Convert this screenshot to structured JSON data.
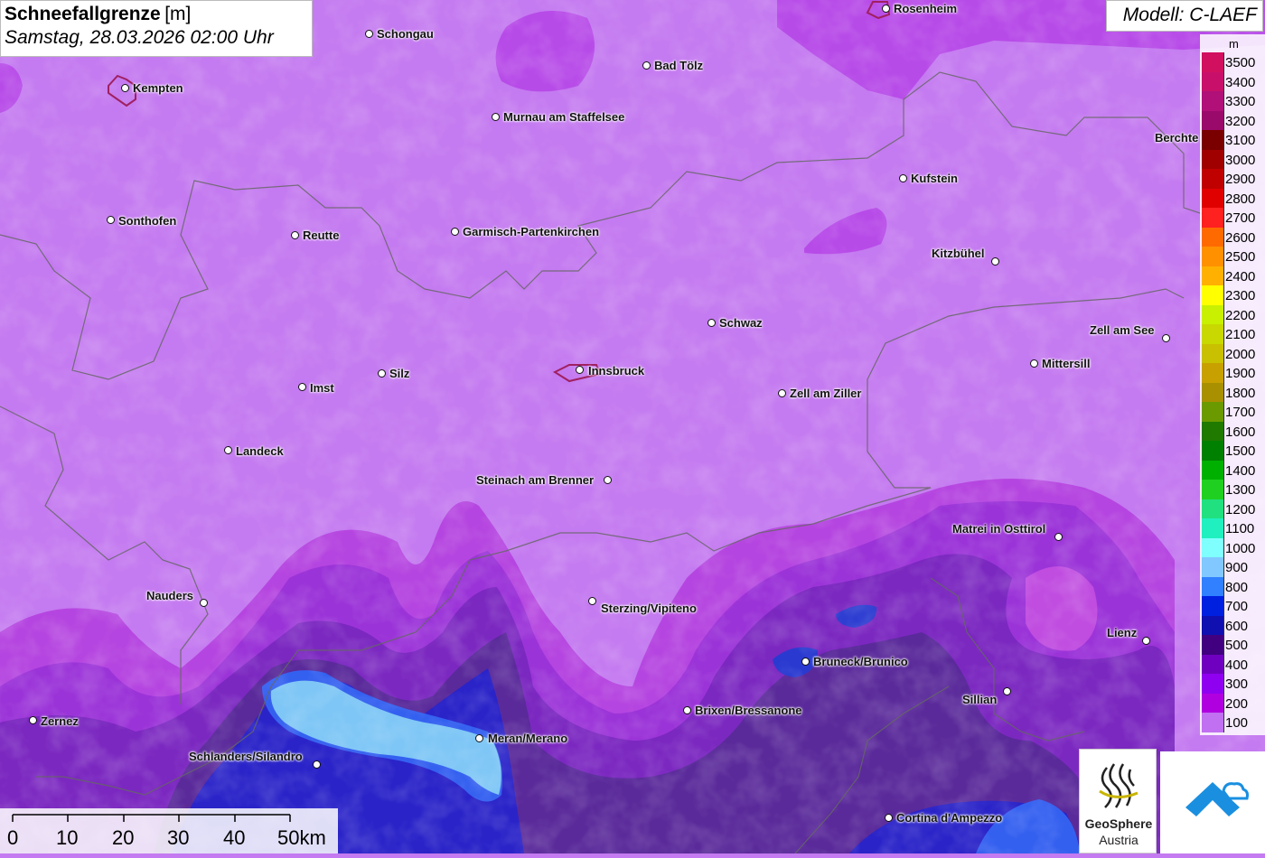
{
  "title": {
    "main": "Schneefallgrenze",
    "unit": "[m]",
    "date": "Samstag, 28.03.2026 02:00 Uhr"
  },
  "model": "Modell: C-LAEF",
  "legend": {
    "unit": "m",
    "entries": [
      {
        "label": "3500",
        "color": "#d1105f"
      },
      {
        "label": "3400",
        "color": "#c8106a"
      },
      {
        "label": "3300",
        "color": "#b01078"
      },
      {
        "label": "3200",
        "color": "#9a0a6a"
      },
      {
        "label": "3100",
        "color": "#7a0000"
      },
      {
        "label": "3000",
        "color": "#a00000"
      },
      {
        "label": "2900",
        "color": "#c00000"
      },
      {
        "label": "2800",
        "color": "#e00000"
      },
      {
        "label": "2700",
        "color": "#ff2020"
      },
      {
        "label": "2600",
        "color": "#ff6a00"
      },
      {
        "label": "2500",
        "color": "#ff9000"
      },
      {
        "label": "2400",
        "color": "#ffb000"
      },
      {
        "label": "2300",
        "color": "#ffff00"
      },
      {
        "label": "2200",
        "color": "#c8f000"
      },
      {
        "label": "2100",
        "color": "#c8d800"
      },
      {
        "label": "2000",
        "color": "#c8c000"
      },
      {
        "label": "1900",
        "color": "#c8a000"
      },
      {
        "label": "1800",
        "color": "#a89000"
      },
      {
        "label": "1700",
        "color": "#6a9a00"
      },
      {
        "label": "1600",
        "color": "#207a00"
      },
      {
        "label": "1500",
        "color": "#008000"
      },
      {
        "label": "1400",
        "color": "#00b000"
      },
      {
        "label": "1300",
        "color": "#20d020"
      },
      {
        "label": "1200",
        "color": "#20e080"
      },
      {
        "label": "1100",
        "color": "#20f0c0"
      },
      {
        "label": "1000",
        "color": "#80ffff"
      },
      {
        "label": "900",
        "color": "#80c8ff"
      },
      {
        "label": "800",
        "color": "#3080ff"
      },
      {
        "label": "700",
        "color": "#0020e0"
      },
      {
        "label": "600",
        "color": "#1010b0"
      },
      {
        "label": "500",
        "color": "#400080"
      },
      {
        "label": "400",
        "color": "#7000c0"
      },
      {
        "label": "300",
        "color": "#9000f0"
      },
      {
        "label": "200",
        "color": "#b000e0"
      },
      {
        "label": "100",
        "color": "#c070f0"
      }
    ]
  },
  "cities": [
    {
      "name": "Schongau"
    },
    {
      "name": "Rosenheim"
    },
    {
      "name": "Kempten"
    },
    {
      "name": "Bad Tölz"
    },
    {
      "name": "Murnau am Staffelsee"
    },
    {
      "name": "Berchte"
    },
    {
      "name": "Kufstein"
    },
    {
      "name": "Sonthofen"
    },
    {
      "name": "Reutte"
    },
    {
      "name": "Garmisch-Partenkirchen"
    },
    {
      "name": "Kitzbühel"
    },
    {
      "name": "Schwaz"
    },
    {
      "name": "Zell am See"
    },
    {
      "name": "Mittersill"
    },
    {
      "name": "Innsbruck"
    },
    {
      "name": "Silz"
    },
    {
      "name": "Imst"
    },
    {
      "name": "Zell am Ziller"
    },
    {
      "name": "Landeck"
    },
    {
      "name": "Steinach am Brenner"
    },
    {
      "name": "Matrei in Osttirol"
    },
    {
      "name": "Nauders"
    },
    {
      "name": "Sterzing/Vipiteno"
    },
    {
      "name": "Lienz"
    },
    {
      "name": "Bruneck/Brunico"
    },
    {
      "name": "Sillian"
    },
    {
      "name": "Brixen/Bressanone"
    },
    {
      "name": "Zernez"
    },
    {
      "name": "Meran/Merano"
    },
    {
      "name": "Schlanders/Silandro"
    },
    {
      "name": "Cortina d'Ampezzo"
    }
  ],
  "scale_bar": {
    "labels": [
      "0",
      "10",
      "20",
      "30",
      "40",
      "50km"
    ]
  },
  "logos": {
    "geosphere_name": "GeoSphere",
    "geosphere_sub": "Austria"
  }
}
